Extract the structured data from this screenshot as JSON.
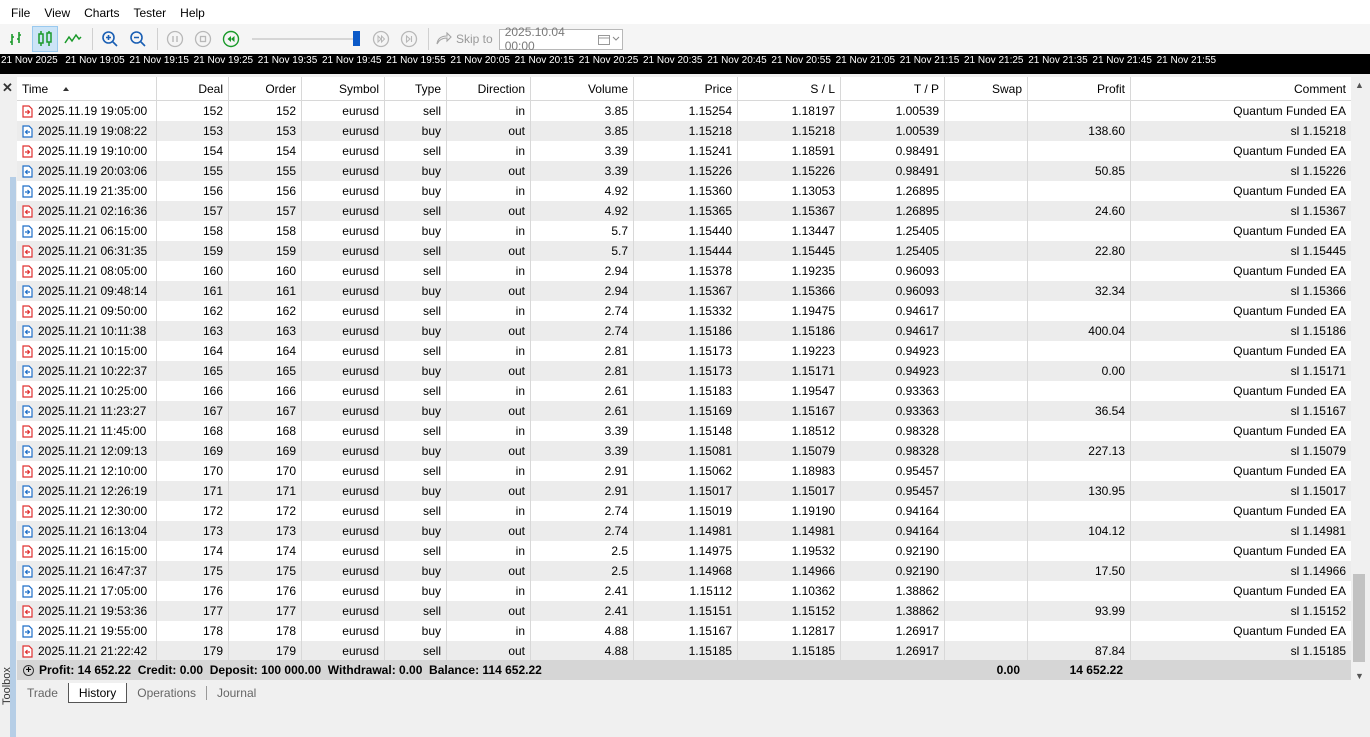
{
  "menu": [
    "File",
    "View",
    "Charts",
    "Tester",
    "Help"
  ],
  "toolbar": {
    "skip_label": "Skip to",
    "skip_date": "2025.10.04 00:00",
    "accent": "#0a59c8"
  },
  "timeline": [
    "21 Nov 2025",
    "21 Nov 19:05",
    "21 Nov 19:15",
    "21 Nov 19:25",
    "21 Nov 19:35",
    "21 Nov 19:45",
    "21 Nov 19:55",
    "21 Nov 20:05",
    "21 Nov 20:15",
    "21 Nov 20:25",
    "21 Nov 20:35",
    "21 Nov 20:45",
    "21 Nov 20:55",
    "21 Nov 21:05",
    "21 Nov 21:15",
    "21 Nov 21:25",
    "21 Nov 21:35",
    "21 Nov 21:45",
    "21 Nov 21:55"
  ],
  "columns": [
    "Time",
    "Deal",
    "Order",
    "Symbol",
    "Type",
    "Direction",
    "Volume",
    "Price",
    "S / L",
    "T / P",
    "Swap",
    "Profit",
    "Comment"
  ],
  "rows": [
    [
      "2025.11.19 19:05:00",
      "152",
      "152",
      "eurusd",
      "sell",
      "in",
      "3.85",
      "1.15254",
      "1.18197",
      "1.00539",
      "",
      "",
      "Quantum Funded EA"
    ],
    [
      "2025.11.19 19:08:22",
      "153",
      "153",
      "eurusd",
      "buy",
      "out",
      "3.85",
      "1.15218",
      "1.15218",
      "1.00539",
      "",
      "138.60",
      "sl 1.15218"
    ],
    [
      "2025.11.19 19:10:00",
      "154",
      "154",
      "eurusd",
      "sell",
      "in",
      "3.39",
      "1.15241",
      "1.18591",
      "0.98491",
      "",
      "",
      "Quantum Funded EA"
    ],
    [
      "2025.11.19 20:03:06",
      "155",
      "155",
      "eurusd",
      "buy",
      "out",
      "3.39",
      "1.15226",
      "1.15226",
      "0.98491",
      "",
      "50.85",
      "sl 1.15226"
    ],
    [
      "2025.11.19 21:35:00",
      "156",
      "156",
      "eurusd",
      "buy",
      "in",
      "4.92",
      "1.15360",
      "1.13053",
      "1.26895",
      "",
      "",
      "Quantum Funded EA"
    ],
    [
      "2025.11.21 02:16:36",
      "157",
      "157",
      "eurusd",
      "sell",
      "out",
      "4.92",
      "1.15365",
      "1.15367",
      "1.26895",
      "",
      "24.60",
      "sl 1.15367"
    ],
    [
      "2025.11.21 06:15:00",
      "158",
      "158",
      "eurusd",
      "buy",
      "in",
      "5.7",
      "1.15440",
      "1.13447",
      "1.25405",
      "",
      "",
      "Quantum Funded EA"
    ],
    [
      "2025.11.21 06:31:35",
      "159",
      "159",
      "eurusd",
      "sell",
      "out",
      "5.7",
      "1.15444",
      "1.15445",
      "1.25405",
      "",
      "22.80",
      "sl 1.15445"
    ],
    [
      "2025.11.21 08:05:00",
      "160",
      "160",
      "eurusd",
      "sell",
      "in",
      "2.94",
      "1.15378",
      "1.19235",
      "0.96093",
      "",
      "",
      "Quantum Funded EA"
    ],
    [
      "2025.11.21 09:48:14",
      "161",
      "161",
      "eurusd",
      "buy",
      "out",
      "2.94",
      "1.15367",
      "1.15366",
      "0.96093",
      "",
      "32.34",
      "sl 1.15366"
    ],
    [
      "2025.11.21 09:50:00",
      "162",
      "162",
      "eurusd",
      "sell",
      "in",
      "2.74",
      "1.15332",
      "1.19475",
      "0.94617",
      "",
      "",
      "Quantum Funded EA"
    ],
    [
      "2025.11.21 10:11:38",
      "163",
      "163",
      "eurusd",
      "buy",
      "out",
      "2.74",
      "1.15186",
      "1.15186",
      "0.94617",
      "",
      "400.04",
      "sl 1.15186"
    ],
    [
      "2025.11.21 10:15:00",
      "164",
      "164",
      "eurusd",
      "sell",
      "in",
      "2.81",
      "1.15173",
      "1.19223",
      "0.94923",
      "",
      "",
      "Quantum Funded EA"
    ],
    [
      "2025.11.21 10:22:37",
      "165",
      "165",
      "eurusd",
      "buy",
      "out",
      "2.81",
      "1.15173",
      "1.15171",
      "0.94923",
      "",
      "0.00",
      "sl 1.15171"
    ],
    [
      "2025.11.21 10:25:00",
      "166",
      "166",
      "eurusd",
      "sell",
      "in",
      "2.61",
      "1.15183",
      "1.19547",
      "0.93363",
      "",
      "",
      "Quantum Funded EA"
    ],
    [
      "2025.11.21 11:23:27",
      "167",
      "167",
      "eurusd",
      "buy",
      "out",
      "2.61",
      "1.15169",
      "1.15167",
      "0.93363",
      "",
      "36.54",
      "sl 1.15167"
    ],
    [
      "2025.11.21 11:45:00",
      "168",
      "168",
      "eurusd",
      "sell",
      "in",
      "3.39",
      "1.15148",
      "1.18512",
      "0.98328",
      "",
      "",
      "Quantum Funded EA"
    ],
    [
      "2025.11.21 12:09:13",
      "169",
      "169",
      "eurusd",
      "buy",
      "out",
      "3.39",
      "1.15081",
      "1.15079",
      "0.98328",
      "",
      "227.13",
      "sl 1.15079"
    ],
    [
      "2025.11.21 12:10:00",
      "170",
      "170",
      "eurusd",
      "sell",
      "in",
      "2.91",
      "1.15062",
      "1.18983",
      "0.95457",
      "",
      "",
      "Quantum Funded EA"
    ],
    [
      "2025.11.21 12:26:19",
      "171",
      "171",
      "eurusd",
      "buy",
      "out",
      "2.91",
      "1.15017",
      "1.15017",
      "0.95457",
      "",
      "130.95",
      "sl 1.15017"
    ],
    [
      "2025.11.21 12:30:00",
      "172",
      "172",
      "eurusd",
      "sell",
      "in",
      "2.74",
      "1.15019",
      "1.19190",
      "0.94164",
      "",
      "",
      "Quantum Funded EA"
    ],
    [
      "2025.11.21 16:13:04",
      "173",
      "173",
      "eurusd",
      "buy",
      "out",
      "2.74",
      "1.14981",
      "1.14981",
      "0.94164",
      "",
      "104.12",
      "sl 1.14981"
    ],
    [
      "2025.11.21 16:15:00",
      "174",
      "174",
      "eurusd",
      "sell",
      "in",
      "2.5",
      "1.14975",
      "1.19532",
      "0.92190",
      "",
      "",
      "Quantum Funded EA"
    ],
    [
      "2025.11.21 16:47:37",
      "175",
      "175",
      "eurusd",
      "buy",
      "out",
      "2.5",
      "1.14968",
      "1.14966",
      "0.92190",
      "",
      "17.50",
      "sl 1.14966"
    ],
    [
      "2025.11.21 17:05:00",
      "176",
      "176",
      "eurusd",
      "buy",
      "in",
      "2.41",
      "1.15112",
      "1.10362",
      "1.38862",
      "",
      "",
      "Quantum Funded EA"
    ],
    [
      "2025.11.21 19:53:36",
      "177",
      "177",
      "eurusd",
      "sell",
      "out",
      "2.41",
      "1.15151",
      "1.15152",
      "1.38862",
      "",
      "93.99",
      "sl 1.15152"
    ],
    [
      "2025.11.21 19:55:00",
      "178",
      "178",
      "eurusd",
      "buy",
      "in",
      "4.88",
      "1.15167",
      "1.12817",
      "1.26917",
      "",
      "",
      "Quantum Funded EA"
    ],
    [
      "2025.11.21 21:22:42",
      "179",
      "179",
      "eurusd",
      "sell",
      "out",
      "4.88",
      "1.15185",
      "1.15185",
      "1.26917",
      "",
      "87.84",
      "sl 1.15185"
    ]
  ],
  "footer": {
    "summary": "Profit: 14 652.22  Credit: 0.00  Deposit: 100 000.00  Withdrawal: 0.00  Balance: 114 652.22",
    "swap": "0.00",
    "profit": "14 652.22"
  },
  "tabs": [
    {
      "label": "Trade",
      "active": false
    },
    {
      "label": "History",
      "active": true
    },
    {
      "label": "Operations",
      "active": false
    },
    {
      "label": "Journal",
      "active": false
    }
  ],
  "toolbox_label": "Toolbox",
  "colors": {
    "sell_icon": "#e03030",
    "buy_icon": "#1e6ec8",
    "timeline_bg": "#000000",
    "footer_bg": "#d6d6d6"
  }
}
